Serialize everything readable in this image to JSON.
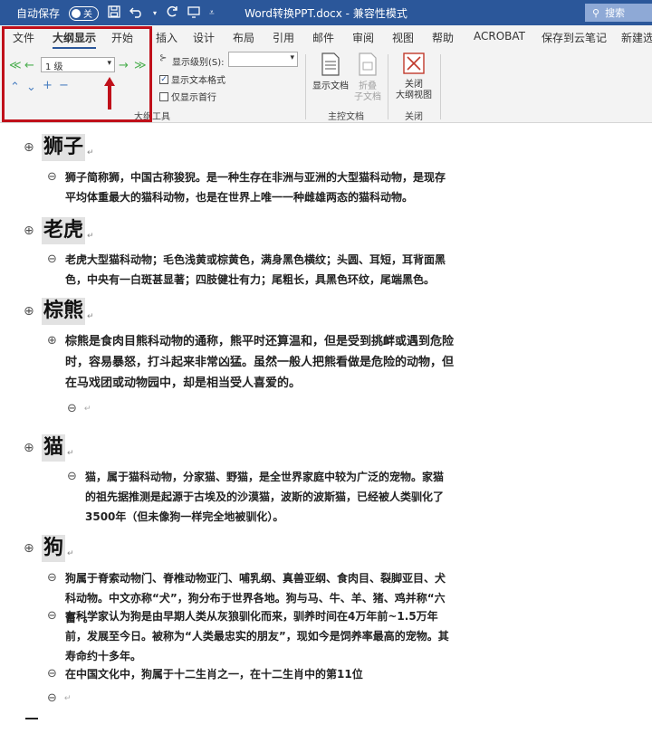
{
  "titlebar": {
    "autosave_label": "自动保存",
    "autosave_state": "关",
    "save_icon": "save-icon",
    "undo_icon": "undo-icon",
    "redo_icon": "redo-icon",
    "doc_title": "Word转换PPT.docx  -  兼容性模式",
    "search_label": "搜索"
  },
  "tabs": [
    "文件",
    "大纲显示",
    "开始",
    "插入",
    "设计",
    "布局",
    "引用",
    "邮件",
    "审阅",
    "视图",
    "帮助",
    "ACROBAT",
    "保存到云笔记",
    "新建选项"
  ],
  "active_tab": "大纲显示",
  "ribbon": {
    "level_value": "1 级",
    "show_level_label": "显示级别(S):",
    "show_level_value": "",
    "show_text_format": "显示文本格式",
    "show_text_format_checked": true,
    "first_line_only": "仅显示首行",
    "first_line_only_checked": false,
    "outline_tools_label": "大纲工具",
    "show_document": "显示文档",
    "collapse_subdocs_1": "折叠",
    "collapse_subdocs_2": "子文档",
    "master_doc_label": "主控文档",
    "close_outline_1": "关闭",
    "close_outline_2": "大纲视图",
    "close_label": "关闭",
    "accent_color": "#2b579a",
    "highlight_color": "#c0101a"
  },
  "document": {
    "sections": [
      {
        "heading": "狮子",
        "body": [
          {
            "text": "狮子简称狮，中国古称狻猊。是一种生存在非洲与亚洲的大型猫科动物，是现存平均体重最大的猫科动物，也是在世界上唯一一种雌雄两态的猫科动物。"
          }
        ]
      },
      {
        "heading": "老虎",
        "body": [
          {
            "text": "老虎大型猫科动物；毛色浅黄或棕黄色，满身黑色横纹；头圆、耳短，耳背面黑色，中央有一白斑甚显著；四肢健壮有力；尾粗长，具黑色环纹，尾端黑色。"
          }
        ]
      },
      {
        "heading": "棕熊",
        "body": [
          {
            "text": "棕熊是食肉目熊科动物的通称，熊平时还算温和，但是受到挑衅或遇到危险时，容易暴怒，打斗起来非常凶猛。虽然一般人把熊看做是危险的动物，但在马戏团或动物园中，却是相当受人喜爱的。"
          }
        ]
      },
      {
        "heading": "猫",
        "body": [
          {
            "text": "猫，属于猫科动物，分家猫、野猫，是全世界家庭中较为广泛的宠物。家猫的祖先据推测是起源于古埃及的沙漠猫，波斯的波斯猫，已经被人类驯化了3500年（但未像狗一样完全地被驯化）。"
          }
        ]
      },
      {
        "heading": "狗",
        "body": [
          {
            "text": "狗属于脊索动物门、脊椎动物亚门、哺乳纲、真兽亚纲、食肉目、裂脚亚目、犬科动物。中文亦称“犬”，狗分布于世界各地。狗与马、牛、羊、猪、鸡并称“六畜”。"
          },
          {
            "text": "有科学家认为狗是由早期人类从灰狼驯化而来，驯养时间在4万年前~1.5万年前，发展至今日。被称为“人类最忠实的朋友”，现如今是饲养率最高的宠物。其寿命约十多年。"
          },
          {
            "text": "在中国文化中，狗属于十二生肖之一，在十二生肖中的第11位"
          }
        ]
      }
    ],
    "para_mark": "↵"
  }
}
